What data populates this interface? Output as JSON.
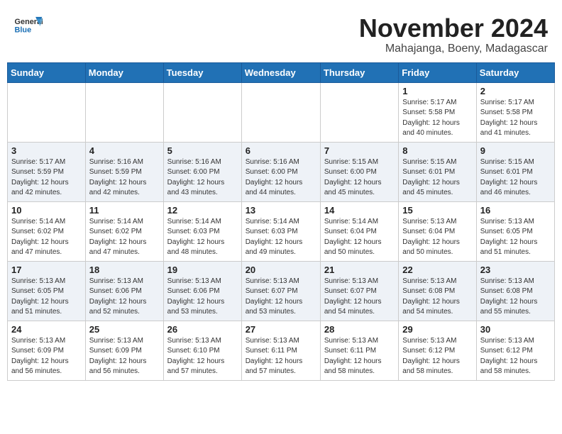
{
  "header": {
    "logo_general": "General",
    "logo_blue": "Blue",
    "month": "November 2024",
    "location": "Mahajanga, Boeny, Madagascar"
  },
  "weekdays": [
    "Sunday",
    "Monday",
    "Tuesday",
    "Wednesday",
    "Thursday",
    "Friday",
    "Saturday"
  ],
  "weeks": [
    {
      "alt": false,
      "days": [
        {
          "num": "",
          "info": ""
        },
        {
          "num": "",
          "info": ""
        },
        {
          "num": "",
          "info": ""
        },
        {
          "num": "",
          "info": ""
        },
        {
          "num": "",
          "info": ""
        },
        {
          "num": "1",
          "info": "Sunrise: 5:17 AM\nSunset: 5:58 PM\nDaylight: 12 hours\nand 40 minutes."
        },
        {
          "num": "2",
          "info": "Sunrise: 5:17 AM\nSunset: 5:58 PM\nDaylight: 12 hours\nand 41 minutes."
        }
      ]
    },
    {
      "alt": true,
      "days": [
        {
          "num": "3",
          "info": "Sunrise: 5:17 AM\nSunset: 5:59 PM\nDaylight: 12 hours\nand 42 minutes."
        },
        {
          "num": "4",
          "info": "Sunrise: 5:16 AM\nSunset: 5:59 PM\nDaylight: 12 hours\nand 42 minutes."
        },
        {
          "num": "5",
          "info": "Sunrise: 5:16 AM\nSunset: 6:00 PM\nDaylight: 12 hours\nand 43 minutes."
        },
        {
          "num": "6",
          "info": "Sunrise: 5:16 AM\nSunset: 6:00 PM\nDaylight: 12 hours\nand 44 minutes."
        },
        {
          "num": "7",
          "info": "Sunrise: 5:15 AM\nSunset: 6:00 PM\nDaylight: 12 hours\nand 45 minutes."
        },
        {
          "num": "8",
          "info": "Sunrise: 5:15 AM\nSunset: 6:01 PM\nDaylight: 12 hours\nand 45 minutes."
        },
        {
          "num": "9",
          "info": "Sunrise: 5:15 AM\nSunset: 6:01 PM\nDaylight: 12 hours\nand 46 minutes."
        }
      ]
    },
    {
      "alt": false,
      "days": [
        {
          "num": "10",
          "info": "Sunrise: 5:14 AM\nSunset: 6:02 PM\nDaylight: 12 hours\nand 47 minutes."
        },
        {
          "num": "11",
          "info": "Sunrise: 5:14 AM\nSunset: 6:02 PM\nDaylight: 12 hours\nand 47 minutes."
        },
        {
          "num": "12",
          "info": "Sunrise: 5:14 AM\nSunset: 6:03 PM\nDaylight: 12 hours\nand 48 minutes."
        },
        {
          "num": "13",
          "info": "Sunrise: 5:14 AM\nSunset: 6:03 PM\nDaylight: 12 hours\nand 49 minutes."
        },
        {
          "num": "14",
          "info": "Sunrise: 5:14 AM\nSunset: 6:04 PM\nDaylight: 12 hours\nand 50 minutes."
        },
        {
          "num": "15",
          "info": "Sunrise: 5:13 AM\nSunset: 6:04 PM\nDaylight: 12 hours\nand 50 minutes."
        },
        {
          "num": "16",
          "info": "Sunrise: 5:13 AM\nSunset: 6:05 PM\nDaylight: 12 hours\nand 51 minutes."
        }
      ]
    },
    {
      "alt": true,
      "days": [
        {
          "num": "17",
          "info": "Sunrise: 5:13 AM\nSunset: 6:05 PM\nDaylight: 12 hours\nand 51 minutes."
        },
        {
          "num": "18",
          "info": "Sunrise: 5:13 AM\nSunset: 6:06 PM\nDaylight: 12 hours\nand 52 minutes."
        },
        {
          "num": "19",
          "info": "Sunrise: 5:13 AM\nSunset: 6:06 PM\nDaylight: 12 hours\nand 53 minutes."
        },
        {
          "num": "20",
          "info": "Sunrise: 5:13 AM\nSunset: 6:07 PM\nDaylight: 12 hours\nand 53 minutes."
        },
        {
          "num": "21",
          "info": "Sunrise: 5:13 AM\nSunset: 6:07 PM\nDaylight: 12 hours\nand 54 minutes."
        },
        {
          "num": "22",
          "info": "Sunrise: 5:13 AM\nSunset: 6:08 PM\nDaylight: 12 hours\nand 54 minutes."
        },
        {
          "num": "23",
          "info": "Sunrise: 5:13 AM\nSunset: 6:08 PM\nDaylight: 12 hours\nand 55 minutes."
        }
      ]
    },
    {
      "alt": false,
      "days": [
        {
          "num": "24",
          "info": "Sunrise: 5:13 AM\nSunset: 6:09 PM\nDaylight: 12 hours\nand 56 minutes."
        },
        {
          "num": "25",
          "info": "Sunrise: 5:13 AM\nSunset: 6:09 PM\nDaylight: 12 hours\nand 56 minutes."
        },
        {
          "num": "26",
          "info": "Sunrise: 5:13 AM\nSunset: 6:10 PM\nDaylight: 12 hours\nand 57 minutes."
        },
        {
          "num": "27",
          "info": "Sunrise: 5:13 AM\nSunset: 6:11 PM\nDaylight: 12 hours\nand 57 minutes."
        },
        {
          "num": "28",
          "info": "Sunrise: 5:13 AM\nSunset: 6:11 PM\nDaylight: 12 hours\nand 58 minutes."
        },
        {
          "num": "29",
          "info": "Sunrise: 5:13 AM\nSunset: 6:12 PM\nDaylight: 12 hours\nand 58 minutes."
        },
        {
          "num": "30",
          "info": "Sunrise: 5:13 AM\nSunset: 6:12 PM\nDaylight: 12 hours\nand 58 minutes."
        }
      ]
    }
  ]
}
